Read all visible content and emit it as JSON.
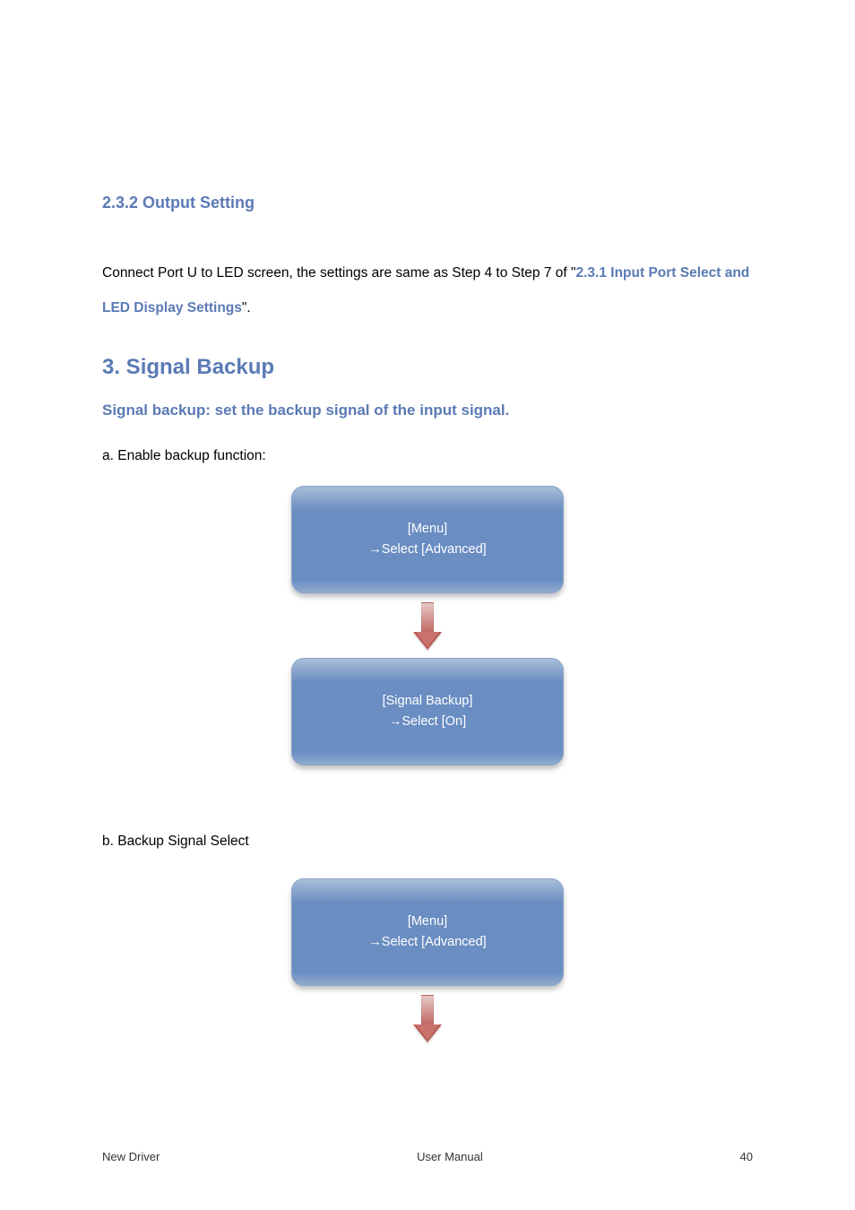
{
  "section_heading": "2.3.2 Output Setting",
  "paragraph": {
    "prefix": "Connect Port U to LED screen, the settings are same as Step 4 to Step 7 of \"",
    "link": "2.3.1 Input Port Select and LED Display Settings",
    "suffix": "\"."
  },
  "chapter_heading": "3. Signal Backup",
  "signal_desc": "Signal backup: set the backup signal of the input signal.",
  "flow_a": {
    "caption": "a. Enable backup function:",
    "box1": {
      "line1": "[Menu]",
      "line2": "→Select [Advanced]"
    },
    "box2": {
      "line1": "[Signal Backup]",
      "line2": "→Select [On]"
    }
  },
  "flow_b": {
    "caption": "b. Backup Signal Select",
    "box1": {
      "line1": "[Menu]",
      "line2": "→Select [Advanced]"
    }
  },
  "footer": {
    "left": "New Driver",
    "center": "User Manual",
    "right": "40"
  }
}
